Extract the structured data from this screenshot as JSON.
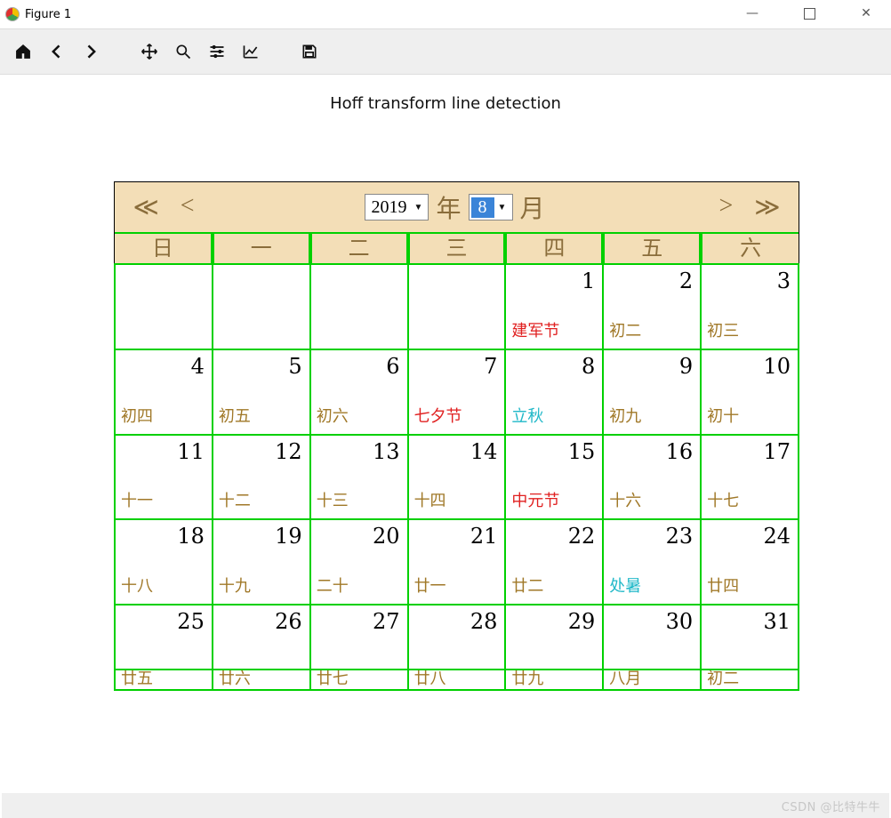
{
  "window": {
    "title": "Figure 1"
  },
  "toolbar_icons": [
    "home",
    "back",
    "forward",
    "move",
    "zoom",
    "sliders",
    "plot",
    "save"
  ],
  "plot": {
    "title": "Hoff transform line detection"
  },
  "nav": {
    "prev_year": "≪",
    "prev_month": "<",
    "next_month": ">",
    "next_year": "≫",
    "year_value": "2019",
    "year_label": "年",
    "month_value": "8",
    "month_label": "月"
  },
  "weekdays": [
    "日",
    "一",
    "二",
    "三",
    "四",
    "五",
    "六"
  ],
  "cells": [
    {
      "day": "",
      "sub": "",
      "cls": ""
    },
    {
      "day": "",
      "sub": "",
      "cls": ""
    },
    {
      "day": "",
      "sub": "",
      "cls": ""
    },
    {
      "day": "",
      "sub": "",
      "cls": ""
    },
    {
      "day": "1",
      "sub": "建军节",
      "cls": "c-red"
    },
    {
      "day": "2",
      "sub": "初二",
      "cls": "c-brown"
    },
    {
      "day": "3",
      "sub": "初三",
      "cls": "c-brown"
    },
    {
      "day": "4",
      "sub": "初四",
      "cls": "c-brown"
    },
    {
      "day": "5",
      "sub": "初五",
      "cls": "c-brown"
    },
    {
      "day": "6",
      "sub": "初六",
      "cls": "c-brown"
    },
    {
      "day": "7",
      "sub": "七夕节",
      "cls": "c-red"
    },
    {
      "day": "8",
      "sub": "立秋",
      "cls": "c-cyan"
    },
    {
      "day": "9",
      "sub": "初九",
      "cls": "c-brown"
    },
    {
      "day": "10",
      "sub": "初十",
      "cls": "c-brown"
    },
    {
      "day": "11",
      "sub": "十一",
      "cls": "c-brown"
    },
    {
      "day": "12",
      "sub": "十二",
      "cls": "c-brown"
    },
    {
      "day": "13",
      "sub": "十三",
      "cls": "c-brown"
    },
    {
      "day": "14",
      "sub": "十四",
      "cls": "c-brown"
    },
    {
      "day": "15",
      "sub": "中元节",
      "cls": "c-red"
    },
    {
      "day": "16",
      "sub": "十六",
      "cls": "c-brown"
    },
    {
      "day": "17",
      "sub": "十七",
      "cls": "c-brown"
    },
    {
      "day": "18",
      "sub": "十八",
      "cls": "c-brown"
    },
    {
      "day": "19",
      "sub": "十九",
      "cls": "c-brown"
    },
    {
      "day": "20",
      "sub": "二十",
      "cls": "c-brown"
    },
    {
      "day": "21",
      "sub": "廿一",
      "cls": "c-brown"
    },
    {
      "day": "22",
      "sub": "廿二",
      "cls": "c-brown"
    },
    {
      "day": "23",
      "sub": "处暑",
      "cls": "c-cyan"
    },
    {
      "day": "24",
      "sub": "廿四",
      "cls": "c-brown"
    },
    {
      "day": "25",
      "sub": "廿五",
      "cls": "c-brown"
    },
    {
      "day": "26",
      "sub": "廿六",
      "cls": "c-brown"
    },
    {
      "day": "27",
      "sub": "廿七",
      "cls": "c-brown"
    },
    {
      "day": "28",
      "sub": "廿八",
      "cls": "c-brown"
    },
    {
      "day": "29",
      "sub": "廿九",
      "cls": "c-brown"
    },
    {
      "day": "30",
      "sub": "八月",
      "cls": "c-brown"
    },
    {
      "day": "31",
      "sub": "初二",
      "cls": "c-brown"
    }
  ],
  "watermark": "CSDN @比特牛牛"
}
